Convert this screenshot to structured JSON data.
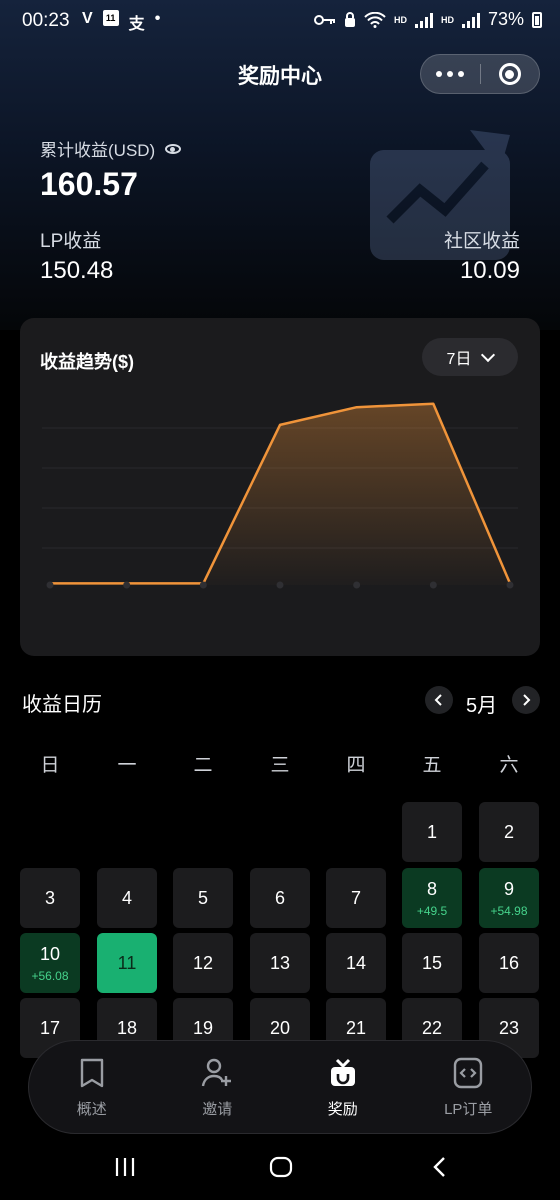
{
  "status_bar": {
    "time": "00:23",
    "left_icons": [
      "v-icon",
      "calendar-icon",
      "alipay-icon",
      "dot-icon"
    ],
    "calendar_day": "11",
    "hd1": "HD",
    "hd2": "HD",
    "battery": "73%"
  },
  "header": {
    "title": "奖励中心"
  },
  "summary": {
    "total_label": "累计收益(USD)",
    "total_value": "160.57",
    "lp_label": "LP收益",
    "lp_value": "150.48",
    "community_label": "社区收益",
    "community_value": "10.09"
  },
  "trend": {
    "title": "收益趋势($)",
    "range": "7日",
    "accent": "#f0943a"
  },
  "chart_data": {
    "type": "area",
    "title": "收益趋势($)",
    "series": [
      {
        "values": [
          0.5,
          0.5,
          0.5,
          49.5,
          54.98,
          56.08,
          0.5
        ]
      }
    ],
    "ylim": [
      0,
      60
    ],
    "grid": true
  },
  "calendar": {
    "title": "收益日历",
    "month": "5月",
    "weekdays": [
      "日",
      "一",
      "二",
      "三",
      "四",
      "五",
      "六"
    ],
    "days": [
      {
        "n": "1"
      },
      {
        "n": "2"
      },
      {
        "n": "3"
      },
      {
        "n": "4"
      },
      {
        "n": "5"
      },
      {
        "n": "6"
      },
      {
        "n": "7"
      },
      {
        "n": "8",
        "e": "+49.5"
      },
      {
        "n": "9",
        "e": "+54.98"
      },
      {
        "n": "10",
        "e": "+56.08"
      },
      {
        "n": "11"
      },
      {
        "n": "12"
      },
      {
        "n": "13"
      },
      {
        "n": "14"
      },
      {
        "n": "15"
      },
      {
        "n": "16"
      },
      {
        "n": "17"
      },
      {
        "n": "18"
      },
      {
        "n": "19"
      },
      {
        "n": "20"
      },
      {
        "n": "21"
      },
      {
        "n": "22"
      },
      {
        "n": "23"
      }
    ],
    "earn_color": "#46d38c",
    "today_color": "#19b071"
  },
  "tabbar": {
    "tabs": [
      {
        "label": "概述",
        "icon": "bookmark-doc-icon"
      },
      {
        "label": "邀请",
        "icon": "add-user-icon"
      },
      {
        "label": "奖励",
        "icon": "gift-icon"
      },
      {
        "label": "LP订单",
        "icon": "code-file-icon"
      }
    ]
  },
  "system_nav": [
    "recents-icon",
    "home-icon",
    "back-icon"
  ]
}
